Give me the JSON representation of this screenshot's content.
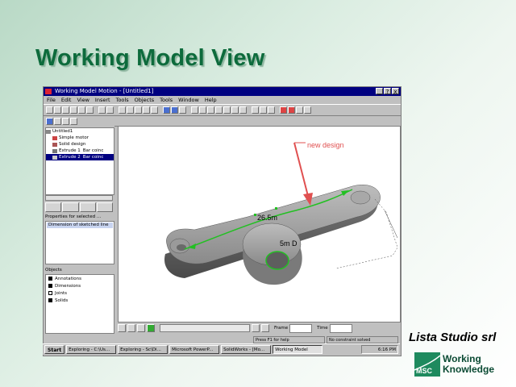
{
  "slide": {
    "title": "Working Model View",
    "company": "Lista Studio srl",
    "logo": {
      "badge": "MSC",
      "line1": "Working",
      "line2": "Knowledge",
      "color": "#1e8a5e"
    }
  },
  "window": {
    "title": "Working Model Motion - [Untitled1]",
    "buttons": [
      "_",
      "?",
      "x"
    ],
    "menu": [
      "File",
      "Edit",
      "View",
      "Insert",
      "Tools",
      "Objects",
      "Tools",
      "Window",
      "Help"
    ]
  },
  "tree": {
    "root": "Untitled1",
    "items": [
      "Simple motor",
      "Solid design",
      "Extrude 1",
      "Extrude 2"
    ],
    "extra": [
      "Bar coinc",
      "Bar coinc"
    ]
  },
  "properties": {
    "header": "Properties for selected ...",
    "selected": "Dimension of sketched line"
  },
  "visibility": {
    "label": "Objects",
    "items": [
      {
        "label": "Annotations",
        "checked": true
      },
      {
        "label": "Dimensions",
        "checked": true
      },
      {
        "label": "Joints",
        "checked": false
      },
      {
        "label": "Solids",
        "checked": true
      }
    ]
  },
  "viewport": {
    "annotation": "new design",
    "dimension_length": "26.5m",
    "dimension_diameter": "5m D",
    "annotation_color": "#e05050",
    "sketch_color": "#22c022"
  },
  "playback": {
    "frame_label": "Frame",
    "time_label": "Time"
  },
  "status": [
    "Press F1 for help",
    "No constraint solved"
  ],
  "taskbar": {
    "start": "Start",
    "tasks": [
      "Exploring - C:\\Us...",
      "Exploring - Sc\\Di...",
      "Microsoft PowerP...",
      "SolidWorks - [Mo...",
      "Working Model"
    ],
    "active_index": 4,
    "clock": "6:16 PM"
  }
}
